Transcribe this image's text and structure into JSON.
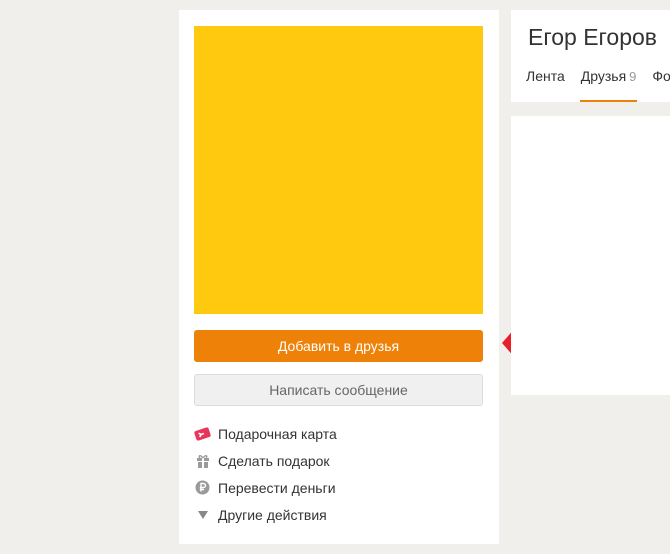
{
  "profile": {
    "name": "Егор Егоров",
    "avatar_color": "#ffc90f"
  },
  "buttons": {
    "add_friend": "Добавить в друзья",
    "send_message": "Написать сообщение"
  },
  "actions": [
    {
      "label": "Подарочная карта",
      "icon": "gift-card-icon"
    },
    {
      "label": "Сделать подарок",
      "icon": "gift-icon"
    },
    {
      "label": "Перевести деньги",
      "icon": "ruble-icon"
    },
    {
      "label": "Другие действия",
      "icon": "triangle-down-icon"
    }
  ],
  "tabs": [
    {
      "label": "Лента",
      "count": ""
    },
    {
      "label": "Друзья",
      "count": "9"
    },
    {
      "label": "Фо",
      "count": ""
    }
  ],
  "colors": {
    "accent": "#ee8208",
    "annotation_arrow": "#e8202a"
  }
}
